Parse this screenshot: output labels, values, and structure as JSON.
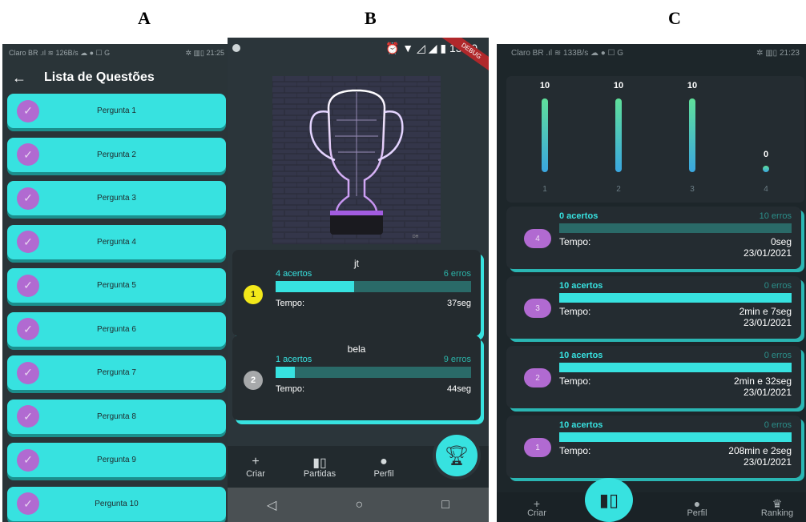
{
  "labels": {
    "a": "A",
    "b": "B",
    "c": "C"
  },
  "panelA": {
    "status_left": "Claro BR  .ıl ≋  126B/s  ☁ ● ☐ G",
    "status_right": "✲ ▥▯ 21:25",
    "back_icon": "←",
    "title": "Lista de Questões",
    "questions": [
      "Pergunta 1",
      "Pergunta 2",
      "Pergunta 3",
      "Pergunta 4",
      "Pergunta 5",
      "Pergunta 6",
      "Pergunta 7",
      "Pergunta 8",
      "Pergunta 9",
      "Pergunta 10"
    ]
  },
  "panelB": {
    "status_time": "⏰ ▼ ◿ ◢ ▮ 13:30",
    "debug": "DEBUG",
    "image_caption": "DH",
    "results": [
      {
        "rank": "1",
        "name": "jt",
        "hits": "4 acertos",
        "errors": "6 erros",
        "fill": 0.4,
        "time_label": "Tempo:",
        "time": "37seg",
        "medal_color": "#f3e81a"
      },
      {
        "rank": "2",
        "name": "bela",
        "hits": "1 acertos",
        "errors": "9 erros",
        "fill": 0.1,
        "time_label": "Tempo:",
        "time": "44seg",
        "medal_color": "#a7a9ab"
      }
    ],
    "nav": {
      "create": "Criar",
      "matches": "Partidas",
      "profile": "Perfil"
    },
    "sysnav": {
      "back": "◁",
      "home": "○",
      "recent": "□"
    }
  },
  "panelC": {
    "status_left": "Claro BR  .ıl ≋  133B/s  ☁ ● ☐ G",
    "status_right": "✲ ▥▯ 21:23",
    "chart_data": {
      "type": "bar",
      "categories": [
        "1",
        "2",
        "3",
        "4"
      ],
      "values": [
        10,
        10,
        10,
        0
      ],
      "ylim": [
        0,
        10
      ]
    },
    "results": [
      {
        "rank": "4",
        "hits": "0 acertos",
        "errors": "10 erros",
        "fill": 0.0,
        "time_label": "Tempo:",
        "time": "0seg",
        "date": "23/01/2021"
      },
      {
        "rank": "3",
        "hits": "10 acertos",
        "errors": "0 erros",
        "fill": 1.0,
        "time_label": "Tempo:",
        "time": "2min e 7seg",
        "date": "23/01/2021"
      },
      {
        "rank": "2",
        "hits": "10 acertos",
        "errors": "0 erros",
        "fill": 1.0,
        "time_label": "Tempo:",
        "time": "2min e 32seg",
        "date": "23/01/2021"
      },
      {
        "rank": "1",
        "hits": "10 acertos",
        "errors": "0 erros",
        "fill": 1.0,
        "time_label": "Tempo:",
        "time": "208min e 2seg",
        "date": "23/01/2021"
      }
    ],
    "nav": {
      "create": "Criar",
      "profile": "Perfil",
      "ranking": "Ranking"
    }
  }
}
